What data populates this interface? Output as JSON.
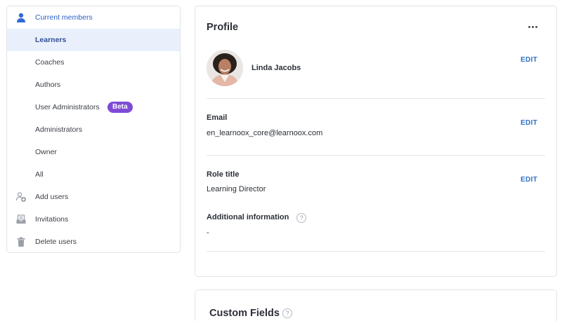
{
  "sidebar": {
    "items": [
      {
        "label": "Current members",
        "icon": "user-icon"
      },
      {
        "label": "Learners"
      },
      {
        "label": "Coaches"
      },
      {
        "label": "Authors"
      },
      {
        "label": "User Administrators",
        "badge": "Beta"
      },
      {
        "label": "Administrators"
      },
      {
        "label": "Owner"
      },
      {
        "label": "All"
      },
      {
        "label": "Add users",
        "icon": "add-user-icon"
      },
      {
        "label": "Invitations",
        "icon": "inbox-icon"
      },
      {
        "label": "Delete users",
        "icon": "trash-icon"
      }
    ]
  },
  "profile": {
    "title": "Profile",
    "name": "Linda Jacobs",
    "edit_label": "EDIT",
    "email_label": "Email",
    "email_value": "en_learnoox_core@learnoox.com",
    "role_label": "Role title",
    "role_value": "Learning Director",
    "additional_label": "Additional information",
    "additional_value": "-"
  },
  "custom_fields": {
    "title": "Custom Fields"
  },
  "colors": {
    "accent": "#2d6fc9",
    "badge": "#7e4bd6",
    "active_bg": "#eaf0fb"
  }
}
